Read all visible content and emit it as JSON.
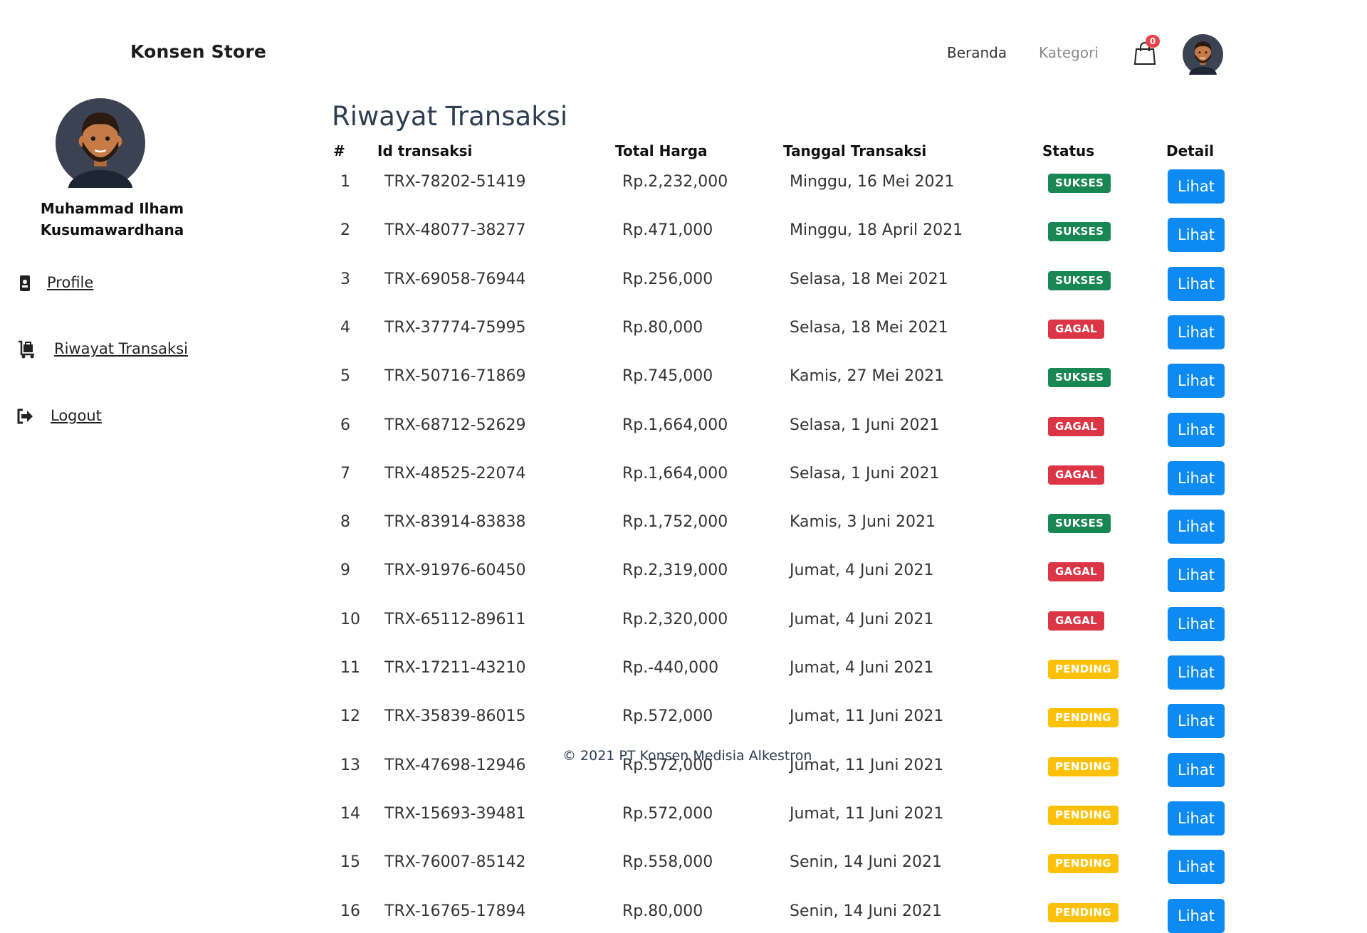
{
  "brand": "Konsen Store",
  "nav": {
    "home": "Beranda",
    "category": "Kategori",
    "cart_count": "0"
  },
  "sidebar": {
    "user_name_line1": "Muhammad Ilham",
    "user_name_line2": "Kusumawardhana",
    "items": [
      {
        "label": "Profile",
        "icon": "id-badge-icon"
      },
      {
        "label": "Riwayat Transaksi",
        "icon": "luggage-cart-icon"
      },
      {
        "label": "Logout",
        "icon": "sign-out-icon"
      }
    ]
  },
  "page": {
    "title": "Riwayat Transaksi"
  },
  "table": {
    "headers": [
      "#",
      "Id transaksi",
      "Total Harga",
      "Tanggal Transaksi",
      "Status",
      "Detail"
    ],
    "button_label": "Lihat",
    "status_colors": {
      "SUKSES": "#198754",
      "GAGAL": "#dc3545",
      "PENDING": "#ffc107"
    },
    "rows": [
      {
        "no": "1",
        "id": "TRX-78202-51419",
        "total": "Rp.2,232,000",
        "date": "Minggu, 16 Mei 2021",
        "status": "SUKSES"
      },
      {
        "no": "2",
        "id": "TRX-48077-38277",
        "total": "Rp.471,000",
        "date": "Minggu, 18 April 2021",
        "status": "SUKSES"
      },
      {
        "no": "3",
        "id": "TRX-69058-76944",
        "total": "Rp.256,000",
        "date": "Selasa, 18 Mei 2021",
        "status": "SUKSES"
      },
      {
        "no": "4",
        "id": "TRX-37774-75995",
        "total": "Rp.80,000",
        "date": "Selasa, 18 Mei 2021",
        "status": "GAGAL"
      },
      {
        "no": "5",
        "id": "TRX-50716-71869",
        "total": "Rp.745,000",
        "date": "Kamis, 27 Mei 2021",
        "status": "SUKSES"
      },
      {
        "no": "6",
        "id": "TRX-68712-52629",
        "total": "Rp.1,664,000",
        "date": "Selasa, 1 Juni 2021",
        "status": "GAGAL"
      },
      {
        "no": "7",
        "id": "TRX-48525-22074",
        "total": "Rp.1,664,000",
        "date": "Selasa, 1 Juni 2021",
        "status": "GAGAL"
      },
      {
        "no": "8",
        "id": "TRX-83914-83838",
        "total": "Rp.1,752,000",
        "date": "Kamis, 3 Juni 2021",
        "status": "SUKSES"
      },
      {
        "no": "9",
        "id": "TRX-91976-60450",
        "total": "Rp.2,319,000",
        "date": "Jumat, 4 Juni 2021",
        "status": "GAGAL"
      },
      {
        "no": "10",
        "id": "TRX-65112-89611",
        "total": "Rp.2,320,000",
        "date": "Jumat, 4 Juni 2021",
        "status": "GAGAL"
      },
      {
        "no": "11",
        "id": "TRX-17211-43210",
        "total": "Rp.-440,000",
        "date": "Jumat, 4 Juni 2021",
        "status": "PENDING"
      },
      {
        "no": "12",
        "id": "TRX-35839-86015",
        "total": "Rp.572,000",
        "date": "Jumat, 11 Juni 2021",
        "status": "PENDING"
      },
      {
        "no": "13",
        "id": "TRX-47698-12946",
        "total": "Rp.572,000",
        "date": "Jumat, 11 Juni 2021",
        "status": "PENDING"
      },
      {
        "no": "14",
        "id": "TRX-15693-39481",
        "total": "Rp.572,000",
        "date": "Jumat, 11 Juni 2021",
        "status": "PENDING"
      },
      {
        "no": "15",
        "id": "TRX-76007-85142",
        "total": "Rp.558,000",
        "date": "Senin, 14 Juni 2021",
        "status": "PENDING"
      },
      {
        "no": "16",
        "id": "TRX-16765-17894",
        "total": "Rp.80,000",
        "date": "Senin, 14 Juni 2021",
        "status": "PENDING"
      }
    ]
  },
  "footer": "© 2021 PT Konsen Medisia Alkestron"
}
